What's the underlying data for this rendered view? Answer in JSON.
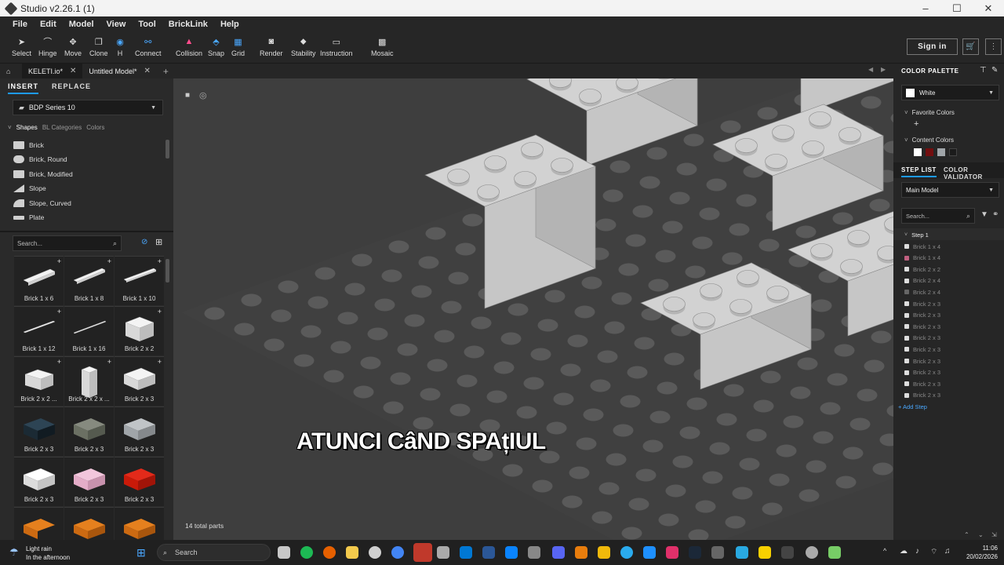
{
  "window": {
    "title": "Studio v2.26.1 (1)",
    "minimize": "–",
    "maximize": "☐",
    "close": "✕"
  },
  "menu": [
    "File",
    "Edit",
    "Model",
    "View",
    "Tool",
    "BrickLink",
    "Help"
  ],
  "toolbar": {
    "tools": [
      {
        "label": "Select",
        "icon": "cursor-icon"
      },
      {
        "label": "Hinge",
        "icon": "hinge-icon"
      },
      {
        "label": "Move",
        "icon": "move-icon"
      },
      {
        "label": "Clone",
        "icon": "clone-icon"
      },
      {
        "label": "H",
        "icon": "hide-icon"
      },
      {
        "label": "Connect",
        "icon": "connect-icon"
      },
      {
        "label": "Collision",
        "icon": "collision-icon"
      },
      {
        "label": "Snap",
        "icon": "snap-icon"
      },
      {
        "label": "Grid",
        "icon": "grid-icon"
      },
      {
        "label": "Render",
        "icon": "camera-icon"
      },
      {
        "label": "Stability",
        "icon": "stability-icon"
      },
      {
        "label": "Instruction",
        "icon": "instruction-icon"
      },
      {
        "label": "Mosaic",
        "icon": "mosaic-icon"
      }
    ],
    "sign_in": "Sign in"
  },
  "tabs": [
    {
      "label": "KELETI.io*",
      "close": "✕"
    },
    {
      "label": "Untitled Model*",
      "close": "✕"
    }
  ],
  "tab_add": "+",
  "left_panel": {
    "tabs": [
      "INSERT",
      "REPLACE"
    ],
    "palette_select": "BDP Series 10",
    "subtabs": [
      "Shapes",
      "BL Categories",
      "Colors"
    ],
    "categories": [
      "Brick",
      "Brick, Round",
      "Brick, Modified",
      "Slope",
      "Slope, Curved",
      "Plate"
    ],
    "search_placeholder": "Search...",
    "parts": [
      {
        "label": "Brick 1 x 6",
        "color": "#f2f2f2"
      },
      {
        "label": "Brick 1 x 8",
        "color": "#f2f2f2"
      },
      {
        "label": "Brick 1 x 10",
        "color": "#f2f2f2"
      },
      {
        "label": "Brick 1 x 12",
        "color": "#f2f2f2"
      },
      {
        "label": "Brick 1 x 16",
        "color": "#f2f2f2"
      },
      {
        "label": "Brick 2 x 2",
        "color": "#f2f2f2"
      },
      {
        "label": "Brick 2 x 2 ...",
        "color": "#f2f2f2"
      },
      {
        "label": "Brick 2 x 2 x ...",
        "color": "#f2f2f2"
      },
      {
        "label": "Brick 2 x 3",
        "color": "#f2f2f2"
      },
      {
        "label": "Brick 2 x 3",
        "color": "#1b2a34"
      },
      {
        "label": "Brick 2 x 3",
        "color": "#6b7063"
      },
      {
        "label": "Brick 2 x 3",
        "color": "#a0a5a9"
      },
      {
        "label": "Brick 2 x 3",
        "color": "#f4f4f4"
      },
      {
        "label": "Brick 2 x 3",
        "color": "#e4adc8"
      },
      {
        "label": "Brick 2 x 3",
        "color": "#c91a09"
      },
      {
        "label": "",
        "color": "#cc6a12"
      },
      {
        "label": "",
        "color": "#cc6a12"
      },
      {
        "label": "",
        "color": "#cc6a12"
      }
    ]
  },
  "viewport": {
    "total_parts": "14 total parts",
    "caption": "ATUNCI CâND SPAțIUL"
  },
  "right_panel": {
    "color_palette_title": "COLOR PALETTE",
    "selected_color": "White",
    "favorite_colors": "Favorite Colors",
    "favorite_add": "+",
    "content_colors": "Content Colors",
    "content_swatches": [
      "#ffffff",
      "#720e0f",
      "#a0a5a9",
      "#1b1b1b"
    ],
    "step_list_tab": "STEP LIST",
    "color_validator_tab": "COLOR VALIDATOR",
    "model_select": "Main Model",
    "search_placeholder": "Search...",
    "step_title": "Step 1",
    "steps": [
      {
        "label": "Brick 1 x 4",
        "color": "#dddddd"
      },
      {
        "label": "Brick 1 x 4",
        "color": "#c06080"
      },
      {
        "label": "Brick 2 x 2",
        "color": "#dddddd"
      },
      {
        "label": "Brick 2 x 4",
        "color": "#dddddd"
      },
      {
        "label": "Brick 2 x 4",
        "color": "#666666"
      },
      {
        "label": "Brick 2 x 3",
        "color": "#dddddd"
      },
      {
        "label": "Brick 2 x 3",
        "color": "#dddddd"
      },
      {
        "label": "Brick 2 x 3",
        "color": "#dddddd"
      },
      {
        "label": "Brick 2 x 3",
        "color": "#dddddd"
      },
      {
        "label": "Brick 2 x 3",
        "color": "#dddddd"
      },
      {
        "label": "Brick 2 x 3",
        "color": "#dddddd"
      },
      {
        "label": "Brick 2 x 3",
        "color": "#dddddd"
      },
      {
        "label": "Brick 2 x 3",
        "color": "#dddddd"
      },
      {
        "label": "Brick 2 x 3",
        "color": "#dddddd"
      }
    ],
    "add_step": "+ Add Step"
  },
  "taskbar": {
    "weather_title": "Light rain",
    "weather_sub": "In the afternoon",
    "search": "Search",
    "time": "11:06",
    "date": "20/02/2026"
  }
}
